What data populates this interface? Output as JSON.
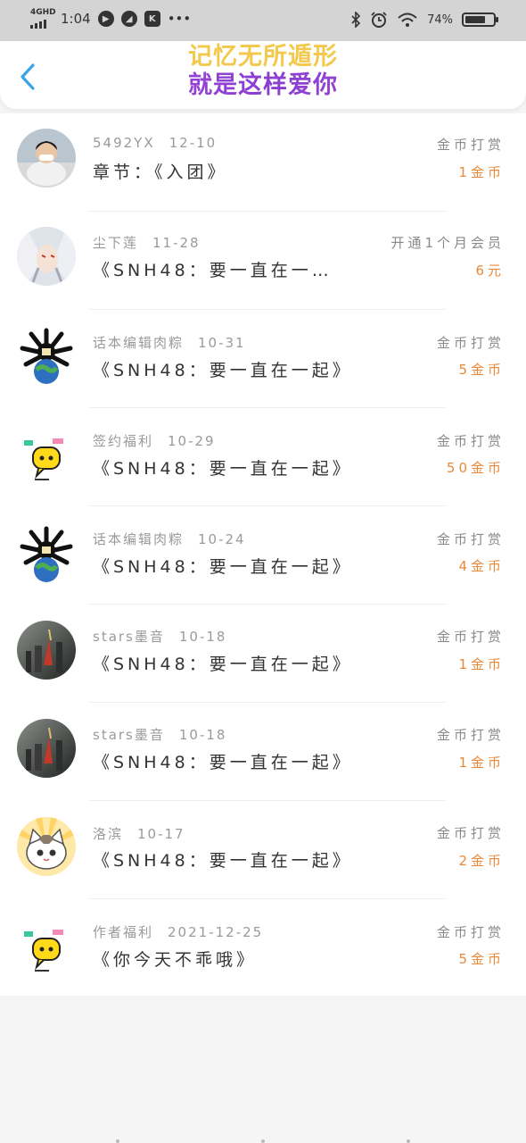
{
  "status_bar": {
    "network": "4GHD",
    "time": "1:04",
    "dots": "•••",
    "battery_text": "74%",
    "battery_level": 0.74
  },
  "header": {
    "title_line1": "记忆无所遁形",
    "title_line2": "就是这样爱你"
  },
  "records": [
    {
      "name": "5492YX",
      "date": "12-10",
      "chapter": "章节：《入团》",
      "type": "金币打赏",
      "amount": "1金币",
      "avatar": "boy-photo"
    },
    {
      "name": "尘下莲",
      "date": "11-28",
      "chapter": "《SNH48：要一直在一…",
      "type": "开通1个月会员",
      "amount": "6元",
      "avatar": "anime-silver-hair"
    },
    {
      "name": "话本编辑肉粽",
      "date": "10-31",
      "chapter": "《SNH48：要一直在一起》",
      "type": "金币打赏",
      "amount": "5金币",
      "avatar": "octopus-globe"
    },
    {
      "name": "签约福利",
      "date": "10-29",
      "chapter": "《SNH48：要一直在一起》",
      "type": "金币打赏",
      "amount": "50金币",
      "avatar": "yellow-chat-bubble"
    },
    {
      "name": "话本编辑肉粽",
      "date": "10-24",
      "chapter": "《SNH48：要一直在一起》",
      "type": "金币打赏",
      "amount": "4金币",
      "avatar": "octopus-globe"
    },
    {
      "name": "stars墨音",
      "date": "10-18",
      "chapter": "《SNH48：要一直在一起》",
      "type": "金币打赏",
      "amount": "1金币",
      "avatar": "dark-city"
    },
    {
      "name": "stars墨音",
      "date": "10-18",
      "chapter": "《SNH48：要一直在一起》",
      "type": "金币打赏",
      "amount": "1金币",
      "avatar": "dark-city"
    },
    {
      "name": "洛滨",
      "date": "10-17",
      "chapter": "《SNH48：要一直在一起》",
      "type": "金币打赏",
      "amount": "2金币",
      "avatar": "cartoon-cat"
    },
    {
      "name": "作者福利",
      "date": "2021-12-25",
      "chapter": "《你今天不乖哦》",
      "type": "金币打赏",
      "amount": "5金币",
      "avatar": "yellow-chat-bubble"
    }
  ],
  "colors": {
    "amount": "#e8893a",
    "back_arrow": "#3ba4e6",
    "title_line1": "#f2c94c",
    "title_line2": "#a14be0"
  }
}
